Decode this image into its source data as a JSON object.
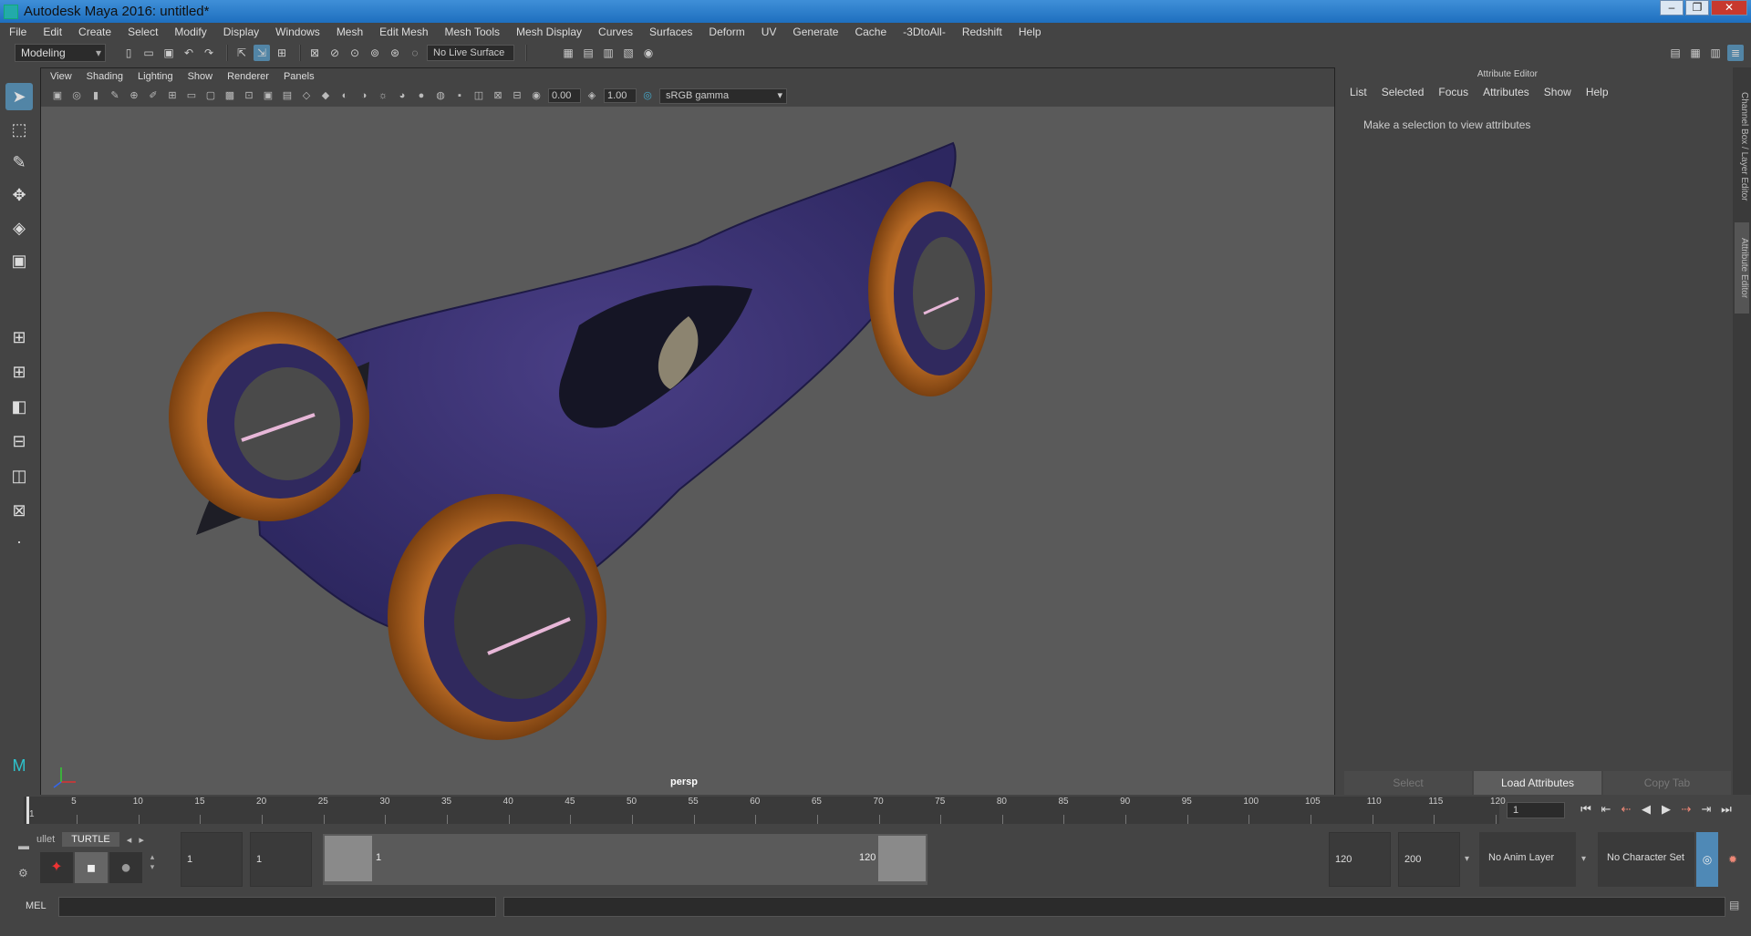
{
  "window": {
    "title": "Autodesk Maya 2016: untitled*"
  },
  "menubar": {
    "items": [
      "File",
      "Edit",
      "Create",
      "Select",
      "Modify",
      "Display",
      "Windows",
      "Mesh",
      "Edit Mesh",
      "Mesh Tools",
      "Mesh Display",
      "Curves",
      "Surfaces",
      "Deform",
      "UV",
      "Generate",
      "Cache",
      "-3DtoAll-",
      "Redshift",
      "Help"
    ]
  },
  "shelf": {
    "mode": "Modeling",
    "live_surface": "No Live Surface"
  },
  "viewport": {
    "menu": [
      "View",
      "Shading",
      "Lighting",
      "Show",
      "Renderer",
      "Panels"
    ],
    "exposure": "0.00",
    "gamma_value": "1.00",
    "color_space": "sRGB gamma",
    "camera": "persp"
  },
  "attribute_editor": {
    "header": "Attribute Editor",
    "menu": [
      "List",
      "Selected",
      "Focus",
      "Attributes",
      "Show",
      "Help"
    ],
    "message": "Make a selection to view attributes",
    "buttons": [
      "Select",
      "Load Attributes",
      "Copy Tab"
    ]
  },
  "side_tabs": {
    "channel_box": "Channel Box / Layer Editor",
    "attribute_editor": "Attribute Editor"
  },
  "timeline": {
    "ticks": [
      "1",
      "5",
      "10",
      "15",
      "20",
      "25",
      "30",
      "35",
      "40",
      "45",
      "50",
      "55",
      "60",
      "65",
      "70",
      "75",
      "80",
      "85",
      "90",
      "95",
      "100",
      "105",
      "110",
      "115",
      "120"
    ],
    "current_frame": "1"
  },
  "range": {
    "start": "1",
    "playback_start": "1",
    "range_start_label": "1",
    "range_end_label": "120",
    "playback_end": "120",
    "end": "200",
    "anim_layer": "No Anim Layer",
    "character_set": "No Character Set"
  },
  "shelf_tabs": {
    "prev": "ullet",
    "active": "TURTLE"
  },
  "mel": {
    "label": "MEL"
  }
}
